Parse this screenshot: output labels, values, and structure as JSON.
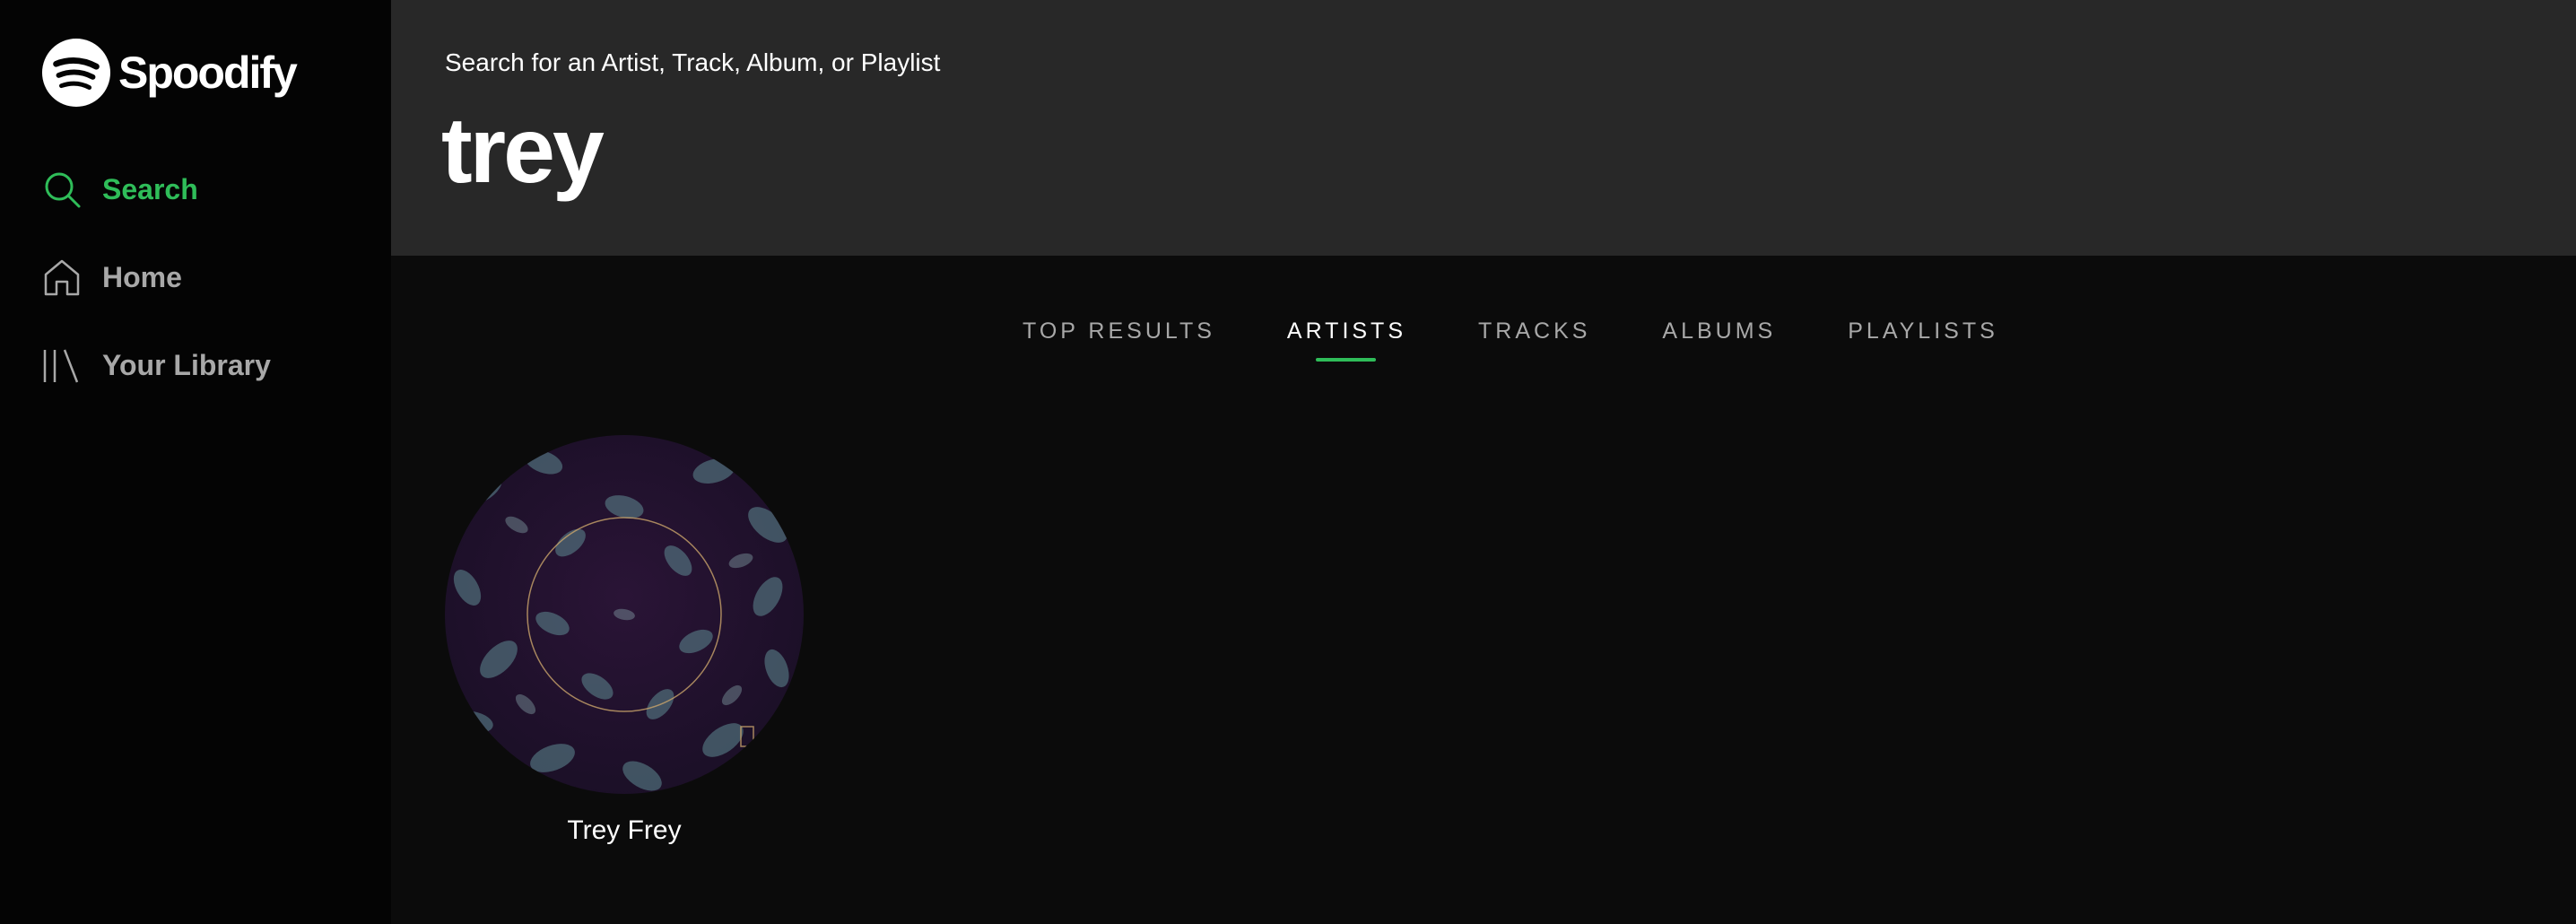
{
  "app": {
    "name": "Spoodify"
  },
  "sidebar": {
    "items": [
      {
        "label": "Search",
        "icon": "search-icon",
        "active": true
      },
      {
        "label": "Home",
        "icon": "home-icon",
        "active": false
      },
      {
        "label": "Your Library",
        "icon": "library-icon",
        "active": false
      }
    ]
  },
  "search": {
    "prompt": "Search for an Artist, Track, Album, or Playlist",
    "value": "trey"
  },
  "tabs": [
    {
      "label": "TOP RESULTS",
      "active": false
    },
    {
      "label": "ARTISTS",
      "active": true
    },
    {
      "label": "TRACKS",
      "active": false
    },
    {
      "label": "ALBUMS",
      "active": false
    },
    {
      "label": "PLAYLISTS",
      "active": false
    }
  ],
  "results": {
    "artists": [
      {
        "name": "Trey Frey",
        "image": "artist-photo-ivy-leaves"
      }
    ]
  },
  "colors": {
    "accent": "#2fbd59",
    "sidebar_bg": "#040404",
    "header_bg": "#282828",
    "main_bg": "#0b0b0b",
    "muted_text": "#a8a8a8"
  }
}
